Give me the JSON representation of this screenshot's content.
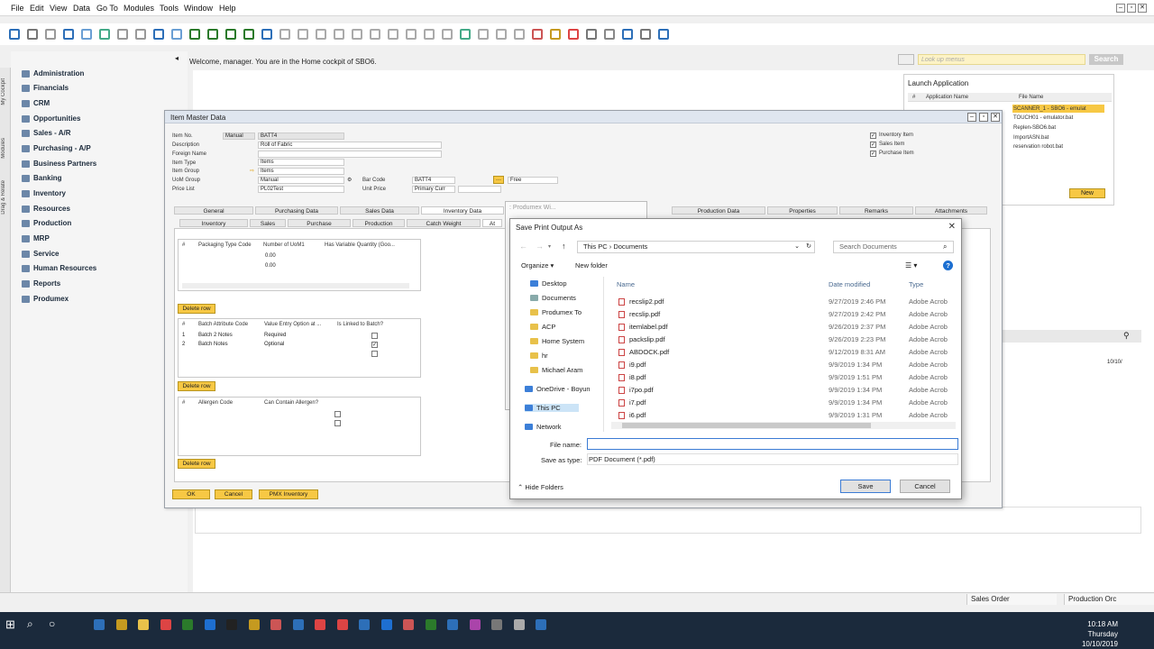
{
  "menu": [
    "File",
    "Edit",
    "View",
    "Data",
    "Go To",
    "Modules",
    "Tools",
    "Window",
    "Help"
  ],
  "cockpit_text": "Welcome, manager. You are in the Home cockpit of SBO6.",
  "lookup": {
    "placeholder": "Look up menus",
    "search_label": "Search"
  },
  "side_tabs": [
    "My Cockpit",
    "Modules",
    "Drag & Relate"
  ],
  "modules": [
    "Administration",
    "Financials",
    "CRM",
    "Opportunities",
    "Sales - A/R",
    "Purchasing - A/P",
    "Business Partners",
    "Banking",
    "Inventory",
    "Resources",
    "Production",
    "MRP",
    "Service",
    "Human Resources",
    "Reports",
    "Produmex"
  ],
  "launch": {
    "title": "Launch Application",
    "col_no": "#",
    "col_app": "Application Name",
    "col_file": "File Name",
    "files": [
      "SCANNER_1 - SBO6 - emulat",
      "TOUCH01 - emulator.bat",
      "Replen-SBO6.bat",
      "ImportASN.bat",
      "reservation robot.bat"
    ],
    "new_label": "New"
  },
  "imd": {
    "title": "Item Master Data",
    "labels": {
      "item_no": "Item No.",
      "description": "Description",
      "foreign_name": "Foreign Name",
      "item_type": "Item Type",
      "item_group": "Item Group",
      "uom_group": "UoM Group",
      "price_list": "Price List",
      "bar_code": "Bar Code",
      "unit_price": "Unit Price"
    },
    "values": {
      "manual": "Manual",
      "item_no": "BATT4",
      "description": "Roll of Fabric",
      "item_type": "Items",
      "item_group": "Items",
      "uom_group": "Manual",
      "price_list": "PL02Test",
      "bar_code": "BATT4",
      "price_currency": "Primary Curr",
      "free": "Free"
    },
    "checks": [
      "Inventory Item",
      "Sales Item",
      "Purchase Item"
    ],
    "tabs": [
      "General",
      "Purchasing Data",
      "Sales Data",
      "Inventory Data",
      "Production Data",
      "Properties",
      "Remarks",
      "Attachments"
    ],
    "subtabs": [
      "Inventory",
      "Sales",
      "Purchase",
      "Production",
      "Catch Weight",
      "At"
    ],
    "grid1": {
      "headers": [
        "#",
        "Packaging Type Code",
        "Number of UoM1",
        "Has Variable Quantity (Goo..."
      ],
      "values": [
        "0.00",
        "0.00"
      ]
    },
    "grid2": {
      "headers": [
        "#",
        "Batch Attribute Code",
        "Value Entry Option at ...",
        "Is Linked to Batch?"
      ],
      "rows": [
        [
          "1",
          "Batch 2 Notes",
          "Required"
        ],
        [
          "2",
          "Batch Notes",
          "Optional"
        ]
      ]
    },
    "grid3": {
      "headers": [
        "#",
        "Allergen Code",
        "Can Contain Allergen?"
      ]
    },
    "delete_row": "Delete row",
    "buttons": [
      "OK",
      "Cancel",
      "PMX Inventory"
    ]
  },
  "bgwin_title": ": Produmex Wi...",
  "dialog": {
    "title": "Save Print Output As",
    "path": [
      "This PC",
      "Documents"
    ],
    "search_placeholder": "Search Documents",
    "organize": "Organize",
    "new_folder": "New folder",
    "tree": [
      "Desktop",
      "Documents",
      "Produmex To",
      "ACP",
      "Home System",
      "hr",
      "Michael Aram",
      "OneDrive - Boyun",
      "This PC",
      "Network"
    ],
    "col_name": "Name",
    "col_date": "Date modified",
    "col_type": "Type",
    "files": [
      {
        "name": "recslip2.pdf",
        "date": "9/27/2019 2:46 PM",
        "type": "Adobe Acrob"
      },
      {
        "name": "recslip.pdf",
        "date": "9/27/2019 2:42 PM",
        "type": "Adobe Acrob"
      },
      {
        "name": "itemlabel.pdf",
        "date": "9/26/2019 2:37 PM",
        "type": "Adobe Acrob"
      },
      {
        "name": "packslip.pdf",
        "date": "9/26/2019 2:23 PM",
        "type": "Adobe Acrob"
      },
      {
        "name": "ABDOCK.pdf",
        "date": "9/12/2019 8:31 AM",
        "type": "Adobe Acrob"
      },
      {
        "name": "i9.pdf",
        "date": "9/9/2019 1:34 PM",
        "type": "Adobe Acrob"
      },
      {
        "name": "i8.pdf",
        "date": "9/9/2019 1:51 PM",
        "type": "Adobe Acrob"
      },
      {
        "name": "i7po.pdf",
        "date": "9/9/2019 1:34 PM",
        "type": "Adobe Acrob"
      },
      {
        "name": "i7.pdf",
        "date": "9/9/2019 1:34 PM",
        "type": "Adobe Acrob"
      },
      {
        "name": "i6.pdf",
        "date": "9/9/2019 1:31 PM",
        "type": "Adobe Acrob"
      }
    ],
    "file_name_label": "File name:",
    "file_name_value": "",
    "save_type_label": "Save as type:",
    "save_type_value": "PDF Document (*.pdf)",
    "hide_folders": "Hide Folders",
    "save_label": "Save",
    "cancel_label": "Cancel"
  },
  "right_panel_value": "10/10/",
  "bottom_tabs": [
    "Sales Order",
    "Production Orc"
  ],
  "clock": {
    "time": "10:18 AM",
    "day": "Thursday",
    "date": "10/10/2019"
  }
}
